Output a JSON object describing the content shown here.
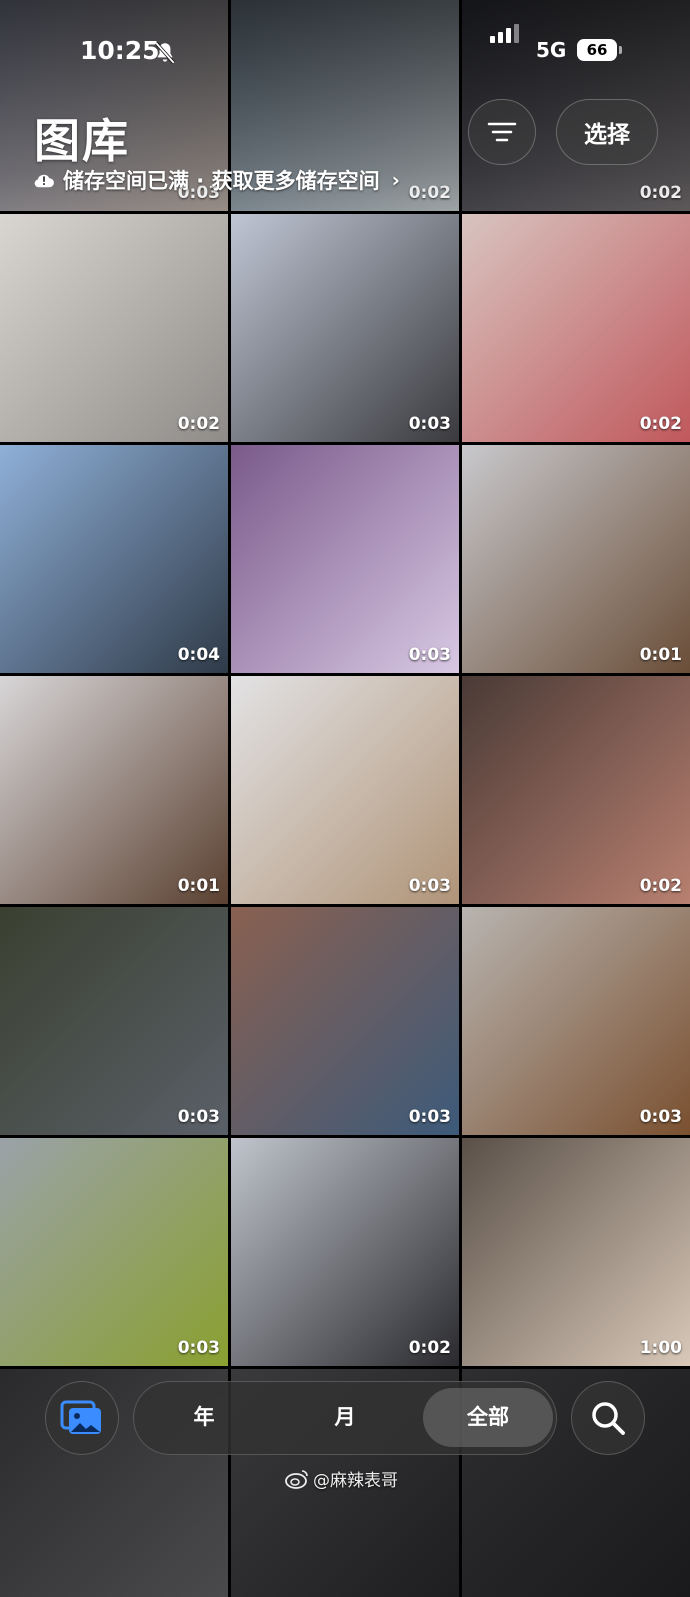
{
  "status_bar": {
    "time": "10:25",
    "network": "5G",
    "battery": "66",
    "silent_icon": "bell-slash-icon"
  },
  "header": {
    "title": "图库",
    "storage_notice": "储存空间已满 · 获取更多储存空间",
    "filter_icon": "filter-lines-icon",
    "select_label": "选择"
  },
  "grid": {
    "tiles": [
      {
        "duration": "0:03",
        "colors": [
          "#6b7080",
          "#9a8f88"
        ]
      },
      {
        "duration": "0:02",
        "colors": [
          "#5b6a78",
          "#a0a6a8"
        ]
      },
      {
        "duration": "0:02",
        "colors": [
          "#2a2c34",
          "#5e5a5c"
        ]
      },
      {
        "duration": "0:02",
        "colors": [
          "#d9d6d2",
          "#8f8b88"
        ]
      },
      {
        "duration": "0:03",
        "colors": [
          "#bfc6d4",
          "#3a3a3e"
        ]
      },
      {
        "duration": "0:02",
        "colors": [
          "#d8c4c0",
          "#c0585c"
        ]
      },
      {
        "duration": "0:04",
        "colors": [
          "#8fb0d8",
          "#2f3a48"
        ]
      },
      {
        "duration": "0:03",
        "colors": [
          "#7a5a8a",
          "#d8c8e4"
        ]
      },
      {
        "duration": "0:01",
        "colors": [
          "#c8c8cc",
          "#6a4e38"
        ]
      },
      {
        "duration": "0:01",
        "colors": [
          "#d8d6d8",
          "#5a4030"
        ]
      },
      {
        "duration": "0:03",
        "colors": [
          "#e2e2e4",
          "#b09478"
        ]
      },
      {
        "duration": "0:02",
        "colors": [
          "#4a3a36",
          "#b88070"
        ]
      },
      {
        "duration": "0:03",
        "colors": [
          "#3a4030",
          "#5a6068"
        ]
      },
      {
        "duration": "0:03",
        "colors": [
          "#8a6050",
          "#3c5a7a"
        ]
      },
      {
        "duration": "0:03",
        "colors": [
          "#b8b4b0",
          "#7a5030"
        ]
      },
      {
        "duration": "0:03",
        "colors": [
          "#9aa2a8",
          "#8aa030"
        ]
      },
      {
        "duration": "0:02",
        "colors": [
          "#c0c4cc",
          "#2a2a2e"
        ]
      },
      {
        "duration": "1:00",
        "colors": [
          "#5a5048",
          "#d8c8b8"
        ]
      },
      {
        "duration": "",
        "colors": [
          "#2a2a2c",
          "#4a4a4c"
        ]
      },
      {
        "duration": "",
        "colors": [
          "#3a3a3c",
          "#1e1e20"
        ]
      },
      {
        "duration": "",
        "colors": [
          "#2e2e30",
          "#1a1a1c"
        ]
      }
    ]
  },
  "bottom_nav": {
    "library_icon": "photos-library-icon",
    "tabs": [
      {
        "label": "年"
      },
      {
        "label": "月"
      },
      {
        "label": "全部",
        "active": true
      }
    ],
    "search_icon": "search-icon"
  },
  "watermark": "@麻辣表哥"
}
